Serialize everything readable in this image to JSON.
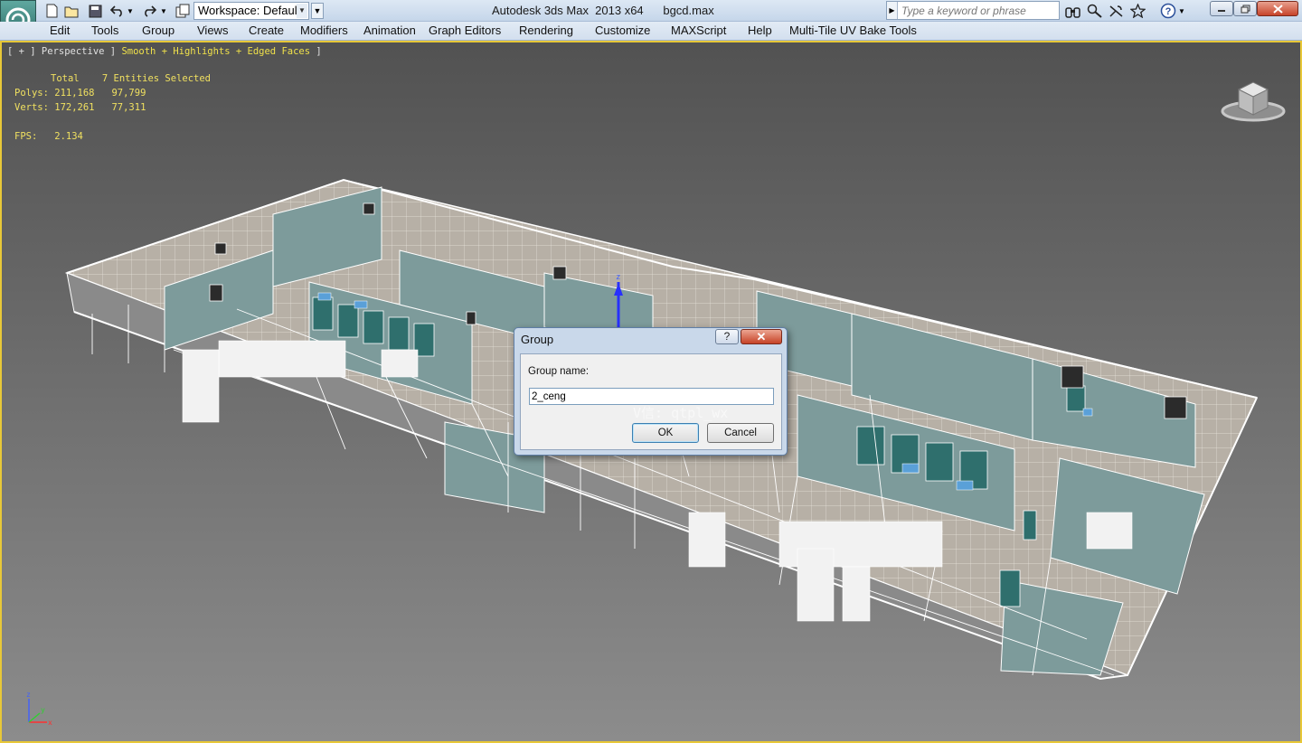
{
  "app": {
    "title": "Autodesk 3ds Max  2013 x64",
    "file_name": "bgcd.max",
    "workspace_value": "Workspace: Default",
    "search_placeholder": "Type a keyword or phrase",
    "accent_color": "#e8c838"
  },
  "quick_access": {
    "icons": [
      "new-file-icon",
      "open-folder-icon",
      "save-icon",
      "undo-icon",
      "redo-icon",
      "project-folder-icon"
    ]
  },
  "toolbar_right": {
    "icons": [
      "binoculars-icon",
      "search-tools-icon",
      "subscription-icon",
      "favorites-star-icon",
      "help-icon"
    ]
  },
  "menu": {
    "items": [
      "Edit",
      "Tools",
      "Group",
      "Views",
      "Create",
      "Modifiers",
      "Animation",
      "Graph Editors",
      "Rendering",
      "Customize",
      "MAXScript",
      "Help",
      "Multi-Tile UV Bake Tools"
    ]
  },
  "viewport": {
    "label_prefix": "[ + ] Perspective ] ",
    "label_shading": "Smooth + Highlights + Edged Faces",
    "label_suffix": " ]",
    "stats": {
      "header": "Total    7 Entities Selected",
      "polys": "Polys: 211,168   97,799",
      "verts": "Verts: 172,261   77,311",
      "fps": "FPS:   2.134"
    }
  },
  "dialog": {
    "title": "Group",
    "help_label": "?",
    "close_label": "✕",
    "field_label": "Group name:",
    "field_value": "2_ceng",
    "ok_label": "OK",
    "cancel_label": "Cancel"
  },
  "watermark": "V信: qtpl_wx",
  "gizmo": {
    "z_label": "z",
    "x_label": "x",
    "y_label": "y"
  }
}
